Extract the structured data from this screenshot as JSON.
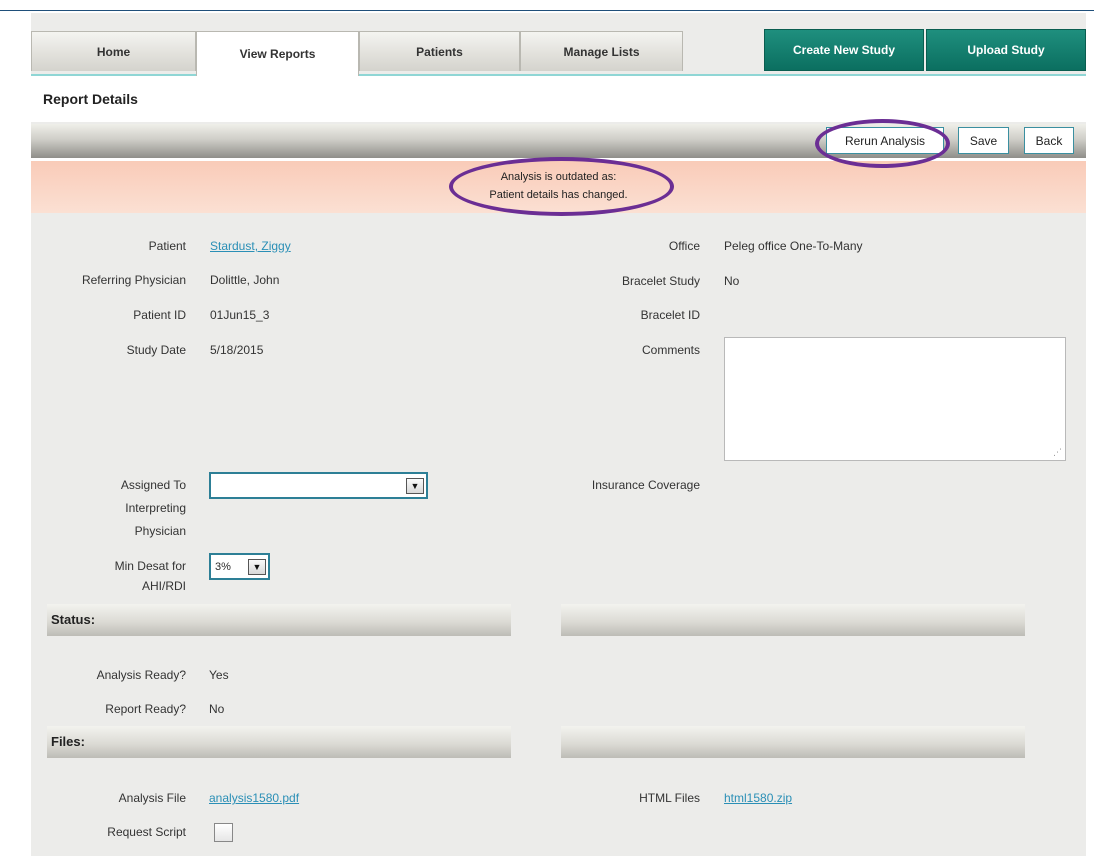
{
  "nav": {
    "tabs": [
      "Home",
      "View Reports",
      "Patients",
      "Manage Lists"
    ],
    "create_label": "Create New Study",
    "upload_label": "Upload Study"
  },
  "page_title": "Report Details",
  "toolbar": {
    "rerun_label": "Rerun Analysis",
    "save_label": "Save",
    "back_label": "Back"
  },
  "warning": {
    "line1": "Analysis is outdated as:",
    "line2": "Patient details has changed."
  },
  "details": {
    "patient_label": "Patient",
    "patient_value": "Stardust, Ziggy",
    "physician_label": "Referring Physician",
    "physician_value": "Dolittle, John",
    "patient_id_label": "Patient ID",
    "patient_id_value": "01Jun15_3",
    "study_date_label": "Study Date",
    "study_date_value": "5/18/2015",
    "office_label": "Office",
    "office_value": "Peleg office One-To-Many",
    "bracelet_study_label": "Bracelet Study",
    "bracelet_study_value": "No",
    "bracelet_id_label": "Bracelet ID",
    "comments_label": "Comments",
    "assigned_label_1": "Assigned To",
    "assigned_label_2": "Interpreting",
    "assigned_label_3": "Physician",
    "assigned_value": "",
    "insurance_label": "Insurance Coverage",
    "min_desat_label_1": "Min Desat for",
    "min_desat_label_2": "AHI/RDI",
    "min_desat_value": "3%"
  },
  "status": {
    "title": "Status:",
    "analysis_ready_label": "Analysis Ready?",
    "analysis_ready_value": "Yes",
    "report_ready_label": "Report Ready?",
    "report_ready_value": "No"
  },
  "files": {
    "title": "Files:",
    "analysis_file_label": "Analysis File",
    "analysis_file_value": "analysis1580.pdf",
    "html_files_label": "HTML Files",
    "html_files_value": "html1580.zip",
    "request_script_label": "Request Script"
  }
}
